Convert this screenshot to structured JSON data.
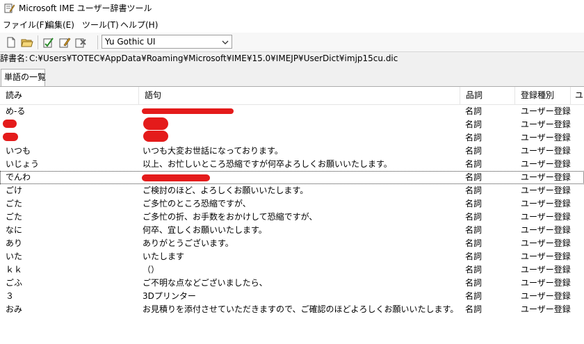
{
  "window": {
    "title": "Microsoft IME ユーザー辞書ツール"
  },
  "menu": [
    "ファイル(F)",
    "編集(E)",
    "ツール(T)",
    "ヘルプ(H)"
  ],
  "toolbar": {
    "buttons": [
      "new-file-icon",
      "open-folder-icon",
      "register-word-icon",
      "edit-word-icon",
      "delete-word-icon"
    ],
    "font": "Yu Gothic UI"
  },
  "path": {
    "label": "辞書名:",
    "value": "C:¥Users¥TOTEC¥AppData¥Roaming¥Microsoft¥IME¥15.0¥IMEJP¥UserDict¥imjp15cu.dic"
  },
  "tab": {
    "label": "単語の一覧"
  },
  "columns": [
    "読み",
    "語句",
    "品詞",
    "登録種別",
    "ユ"
  ],
  "rows": [
    {
      "yomi": "め-る",
      "goku": "",
      "hinshi": "名詞",
      "type": "ユーザー登録"
    },
    {
      "yomi": "",
      "goku": "",
      "hinshi": "名詞",
      "type": "ユーザー登録"
    },
    {
      "yomi": "",
      "goku": "",
      "hinshi": "名詞",
      "type": "ユーザー登録"
    },
    {
      "yomi": "いつも",
      "goku": "いつも大変お世話になっております。",
      "hinshi": "名詞",
      "type": "ユーザー登録"
    },
    {
      "yomi": "いじょう",
      "goku": "以上、お忙しいところ恐縮ですが何卒よろしくお願いいたします。",
      "hinshi": "名詞",
      "type": "ユーザー登録"
    },
    {
      "yomi": "でんわ",
      "goku": "",
      "hinshi": "名詞",
      "type": "ユーザー登録"
    },
    {
      "yomi": "ごけ",
      "goku": "ご検討のほど、よろしくお願いいたします。",
      "hinshi": "名詞",
      "type": "ユーザー登録"
    },
    {
      "yomi": "ごた",
      "goku": "ご多忙のところ恐縮ですが、",
      "hinshi": "名詞",
      "type": "ユーザー登録"
    },
    {
      "yomi": "ごた",
      "goku": "ご多忙の折、お手数をおかけして恐縮ですが、",
      "hinshi": "名詞",
      "type": "ユーザー登録"
    },
    {
      "yomi": "なに",
      "goku": "何卒、宜しくお願いいたします。",
      "hinshi": "名詞",
      "type": "ユーザー登録"
    },
    {
      "yomi": "あり",
      "goku": "ありがとうございます。",
      "hinshi": "名詞",
      "type": "ユーザー登録"
    },
    {
      "yomi": "いた",
      "goku": "いたします",
      "hinshi": "名詞",
      "type": "ユーザー登録"
    },
    {
      "yomi": "ｋｋ",
      "goku": "（）",
      "hinshi": "名詞",
      "type": "ユーザー登録"
    },
    {
      "yomi": "ごふ",
      "goku": "ご不明な点などございましたら、",
      "hinshi": "名詞",
      "type": "ユーザー登録"
    },
    {
      "yomi": "３",
      "goku": "3Dプリンター",
      "hinshi": "名詞",
      "type": "ユーザー登録"
    },
    {
      "yomi": "おみ",
      "goku": "お見積りを添付させていただきますので、ご確認のほどよろしくお願いいたします。",
      "hinshi": "名詞",
      "type": "ユーザー登録"
    }
  ],
  "colors": {
    "redaction": "#e41b1b",
    "toolbar_bg": "#f7f7f7",
    "path_bg": "#f0f0f0"
  }
}
